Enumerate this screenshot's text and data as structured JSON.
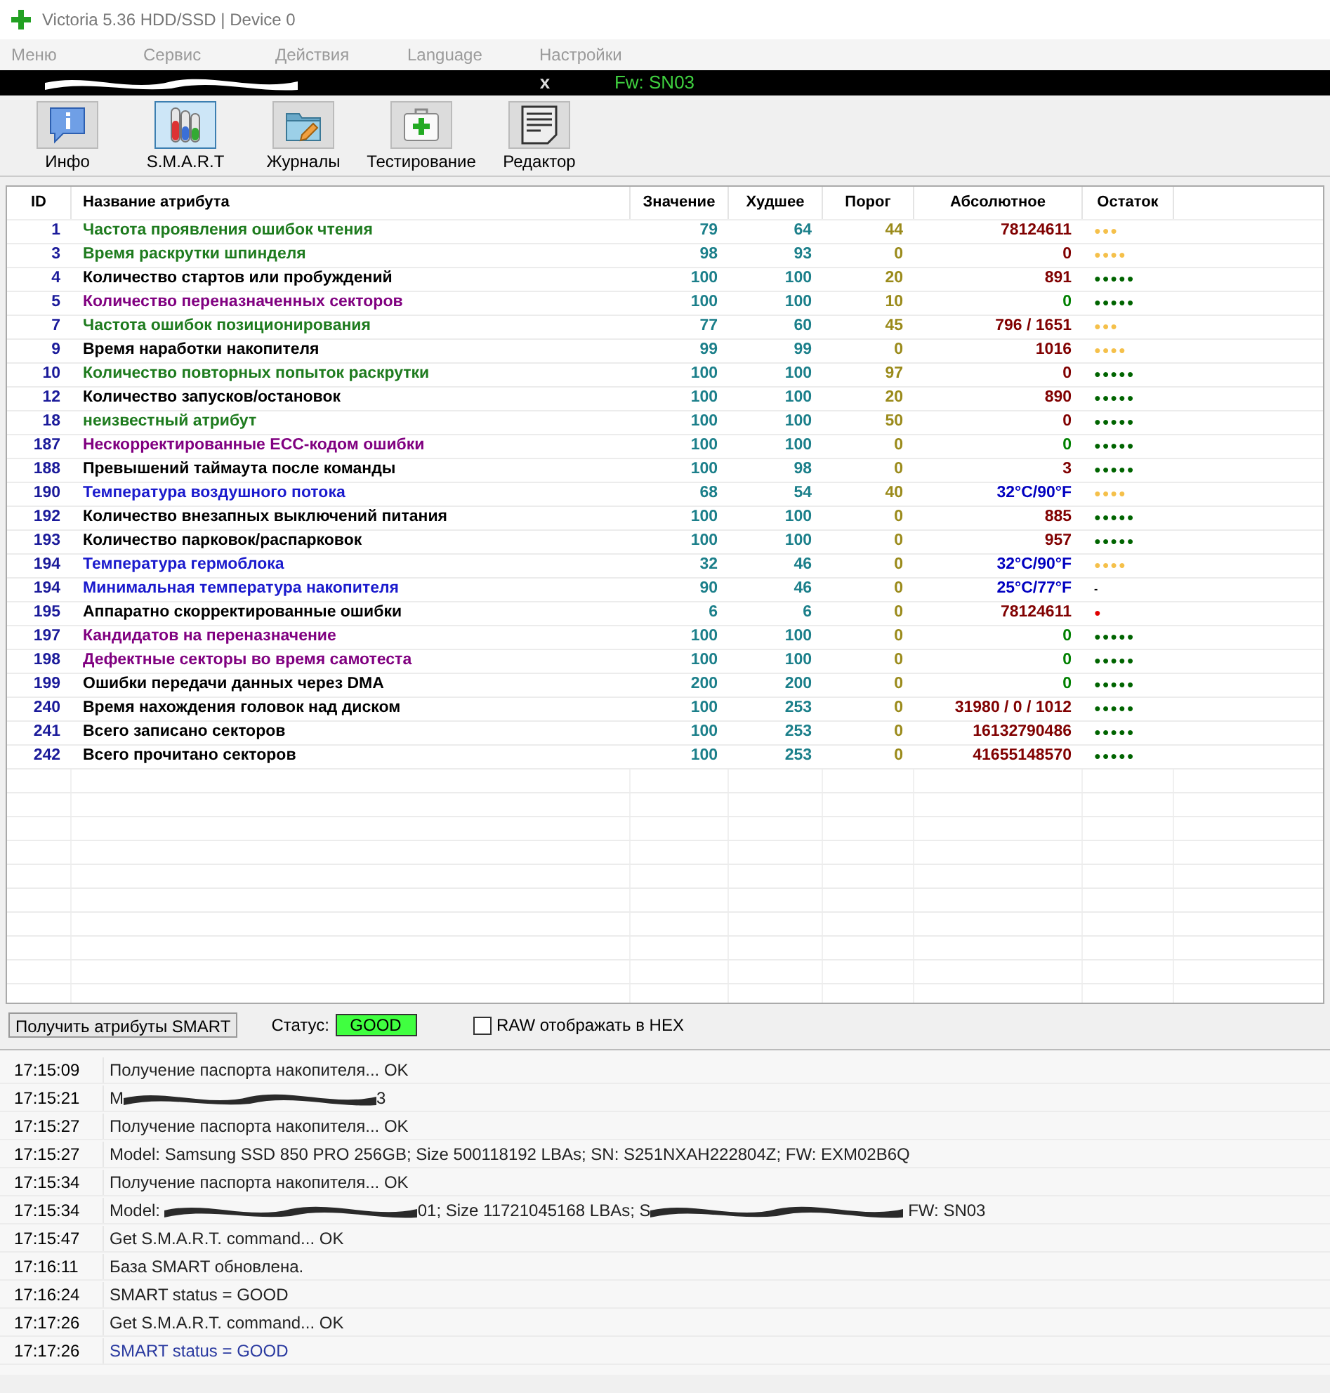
{
  "window": {
    "title": "Victoria 5.36 HDD/SSD | Device 0"
  },
  "menu": [
    "Меню",
    "Сервис",
    "Действия",
    "Language",
    "Настройки"
  ],
  "device_bar": {
    "close": "x",
    "firmware": "Fw: SN03"
  },
  "toolbar": [
    {
      "label": "Инфо",
      "kind": "info",
      "selected": false
    },
    {
      "label": "S.M.A.R.T",
      "kind": "smart",
      "selected": true
    },
    {
      "label": "Журналы",
      "kind": "logs",
      "selected": false
    },
    {
      "label": "Тестирование",
      "kind": "test",
      "selected": false
    },
    {
      "label": "Редактор",
      "kind": "editor",
      "selected": false
    }
  ],
  "table": {
    "columns": [
      "ID",
      "Название атрибута",
      "Значение",
      "Худшее",
      "Порог",
      "Абсолютное",
      "Остаток"
    ],
    "rows": [
      {
        "id": "1",
        "name": {
          "text": "Частота проявления ошибок чтения",
          "color": "#1e7b1e"
        },
        "value": "79",
        "worst": "64",
        "threshold": "44",
        "raw": {
          "text": "78124611",
          "color": "#800000"
        },
        "remaining": {
          "text": "●●●",
          "color": "#f5c04a"
        }
      },
      {
        "id": "3",
        "name": {
          "text": "Время раскрутки шпинделя",
          "color": "#1e7b1e"
        },
        "value": "98",
        "worst": "93",
        "threshold": "0",
        "raw": {
          "text": "0",
          "color": "#800000"
        },
        "remaining": {
          "text": "●●●●",
          "color": "#f5c04a"
        }
      },
      {
        "id": "4",
        "name": {
          "text": "Количество стартов или пробуждений",
          "color": "#000000"
        },
        "value": "100",
        "worst": "100",
        "threshold": "20",
        "raw": {
          "text": "891",
          "color": "#800000"
        },
        "remaining": {
          "text": "●●●●●",
          "color": "#006400"
        }
      },
      {
        "id": "5",
        "name": {
          "text": "Количество переназначенных секторов",
          "color": "#800080"
        },
        "value": "100",
        "worst": "100",
        "threshold": "10",
        "raw": {
          "text": "0",
          "color": "#008000"
        },
        "remaining": {
          "text": "●●●●●",
          "color": "#006400"
        }
      },
      {
        "id": "7",
        "name": {
          "text": "Частота ошибок позиционирования",
          "color": "#1e7b1e"
        },
        "value": "77",
        "worst": "60",
        "threshold": "45",
        "raw": {
          "text": "796 / 1651",
          "color": "#800000"
        },
        "remaining": {
          "text": "●●●",
          "color": "#f5c04a"
        }
      },
      {
        "id": "9",
        "name": {
          "text": "Время наработки накопителя",
          "color": "#000000"
        },
        "value": "99",
        "worst": "99",
        "threshold": "0",
        "raw": {
          "text": "1016",
          "color": "#800000"
        },
        "remaining": {
          "text": "●●●●",
          "color": "#f5c04a"
        }
      },
      {
        "id": "10",
        "name": {
          "text": "Количество повторных попыток раскрутки",
          "color": "#1e7b1e"
        },
        "value": "100",
        "worst": "100",
        "threshold": "97",
        "raw": {
          "text": "0",
          "color": "#800000"
        },
        "remaining": {
          "text": "●●●●●",
          "color": "#006400"
        }
      },
      {
        "id": "12",
        "name": {
          "text": "Количество запусков/остановок",
          "color": "#000000"
        },
        "value": "100",
        "worst": "100",
        "threshold": "20",
        "raw": {
          "text": "890",
          "color": "#800000"
        },
        "remaining": {
          "text": "●●●●●",
          "color": "#006400"
        }
      },
      {
        "id": "18",
        "name": {
          "text": "неизвестный атрибут",
          "color": "#1e7b1e"
        },
        "value": "100",
        "worst": "100",
        "threshold": "50",
        "raw": {
          "text": "0",
          "color": "#800000"
        },
        "remaining": {
          "text": "●●●●●",
          "color": "#006400"
        }
      },
      {
        "id": "187",
        "name": {
          "text": "Нескорректированные ECC-кодом ошибки",
          "color": "#800080"
        },
        "value": "100",
        "worst": "100",
        "threshold": "0",
        "raw": {
          "text": "0",
          "color": "#008000"
        },
        "remaining": {
          "text": "●●●●●",
          "color": "#006400"
        }
      },
      {
        "id": "188",
        "name": {
          "text": "Превышений таймаута после команды",
          "color": "#000000"
        },
        "value": "100",
        "worst": "98",
        "threshold": "0",
        "raw": {
          "text": "3",
          "color": "#800000"
        },
        "remaining": {
          "text": "●●●●●",
          "color": "#006400"
        }
      },
      {
        "id": "190",
        "name": {
          "text": "Температура воздушного потока",
          "color": "#1a1acd"
        },
        "value": "68",
        "worst": "54",
        "threshold": "40",
        "raw": {
          "text": "32°C/90°F",
          "color": "#0000c0"
        },
        "remaining": {
          "text": "●●●●",
          "color": "#f5c04a"
        }
      },
      {
        "id": "192",
        "name": {
          "text": "Количество внезапных выключений питания",
          "color": "#000000"
        },
        "value": "100",
        "worst": "100",
        "threshold": "0",
        "raw": {
          "text": "885",
          "color": "#800000"
        },
        "remaining": {
          "text": "●●●●●",
          "color": "#006400"
        }
      },
      {
        "id": "193",
        "name": {
          "text": "Количество парковок/распарковок",
          "color": "#000000"
        },
        "value": "100",
        "worst": "100",
        "threshold": "0",
        "raw": {
          "text": "957",
          "color": "#800000"
        },
        "remaining": {
          "text": "●●●●●",
          "color": "#006400"
        }
      },
      {
        "id": "194",
        "name": {
          "text": "Температура гермоблока",
          "color": "#1a1acd"
        },
        "value": "32",
        "worst": "46",
        "threshold": "0",
        "raw": {
          "text": "32°C/90°F",
          "color": "#0000c0"
        },
        "remaining": {
          "text": "●●●●",
          "color": "#f5c04a"
        }
      },
      {
        "id": "194",
        "name": {
          "text": "Минимальная температура накопителя",
          "color": "#1a1acd"
        },
        "value": "90",
        "worst": "46",
        "threshold": "0",
        "raw": {
          "text": "25°C/77°F",
          "color": "#0000c0"
        },
        "remaining": {
          "text": "-",
          "color": "#000000"
        }
      },
      {
        "id": "195",
        "name": {
          "text": "Аппаратно скорректированные ошибки",
          "color": "#000000"
        },
        "value": "6",
        "worst": "6",
        "threshold": "0",
        "raw": {
          "text": "78124611",
          "color": "#800000"
        },
        "remaining": {
          "text": "●",
          "color": "#e00000"
        }
      },
      {
        "id": "197",
        "name": {
          "text": "Кандидатов на переназначение",
          "color": "#800080"
        },
        "value": "100",
        "worst": "100",
        "threshold": "0",
        "raw": {
          "text": "0",
          "color": "#008000"
        },
        "remaining": {
          "text": "●●●●●",
          "color": "#006400"
        }
      },
      {
        "id": "198",
        "name": {
          "text": "Дефектные секторы во время самотеста",
          "color": "#800080"
        },
        "value": "100",
        "worst": "100",
        "threshold": "0",
        "raw": {
          "text": "0",
          "color": "#008000"
        },
        "remaining": {
          "text": "●●●●●",
          "color": "#006400"
        }
      },
      {
        "id": "199",
        "name": {
          "text": "Ошибки передачи данных через DMA",
          "color": "#000000"
        },
        "value": "200",
        "worst": "200",
        "threshold": "0",
        "raw": {
          "text": "0",
          "color": "#008000"
        },
        "remaining": {
          "text": "●●●●●",
          "color": "#006400"
        }
      },
      {
        "id": "240",
        "name": {
          "text": "Время нахождения головок над диском",
          "color": "#000000"
        },
        "value": "100",
        "worst": "253",
        "threshold": "0",
        "raw": {
          "text": "31980 / 0 / 1012",
          "color": "#800000"
        },
        "remaining": {
          "text": "●●●●●",
          "color": "#006400"
        }
      },
      {
        "id": "241",
        "name": {
          "text": "Всего записано секторов",
          "color": "#000000"
        },
        "value": "100",
        "worst": "253",
        "threshold": "0",
        "raw": {
          "text": "16132790486",
          "color": "#800000"
        },
        "remaining": {
          "text": "●●●●●",
          "color": "#006400"
        }
      },
      {
        "id": "242",
        "name": {
          "text": "Всего прочитано секторов",
          "color": "#000000"
        },
        "value": "100",
        "worst": "253",
        "threshold": "0",
        "raw": {
          "text": "41655148570",
          "color": "#800000"
        },
        "remaining": {
          "text": "●●●●●",
          "color": "#006400"
        }
      }
    ]
  },
  "controls": {
    "button": "Получить атрибуты SMART",
    "status_label": "Статус:",
    "status": "GOOD",
    "hex_checkbox": {
      "label": "RAW отображать в HEX",
      "checked": false
    }
  },
  "log": [
    {
      "time": "17:15:09",
      "parts": [
        {
          "kind": "text",
          "text": "Получение паспорта накопителя... OK"
        }
      ]
    },
    {
      "time": "17:15:21",
      "parts": [
        {
          "kind": "text",
          "text": "M"
        },
        {
          "kind": "redacted"
        },
        {
          "kind": "text",
          "text": "3"
        }
      ]
    },
    {
      "time": "17:15:27",
      "parts": [
        {
          "kind": "text",
          "text": "Получение паспорта накопителя... OK"
        }
      ]
    },
    {
      "time": "17:15:27",
      "parts": [
        {
          "kind": "text",
          "text": "Model: Samsung SSD 850 PRO 256GB; Size 500118192 LBAs; SN: S251NXAH222804Z; FW: EXM02B6Q"
        }
      ]
    },
    {
      "time": "17:15:34",
      "parts": [
        {
          "kind": "text",
          "text": "Получение паспорта накопителя... OK"
        }
      ]
    },
    {
      "time": "17:15:34",
      "parts": [
        {
          "kind": "text",
          "text": "Model: "
        },
        {
          "kind": "redacted"
        },
        {
          "kind": "text",
          "text": "01; Size 11721045168 LBAs; S"
        },
        {
          "kind": "redacted"
        },
        {
          "kind": "text",
          "text": " FW: SN03"
        }
      ]
    },
    {
      "time": "17:15:47",
      "parts": [
        {
          "kind": "text",
          "text": "Get S.M.A.R.T. command... OK"
        }
      ]
    },
    {
      "time": "17:16:11",
      "parts": [
        {
          "kind": "text",
          "text": "База SMART обновлена."
        }
      ]
    },
    {
      "time": "17:16:24",
      "parts": [
        {
          "kind": "text",
          "text": "SMART status = GOOD"
        }
      ]
    },
    {
      "time": "17:17:26",
      "parts": [
        {
          "kind": "text",
          "text": "Get S.M.A.R.T. command... OK"
        }
      ]
    },
    {
      "time": "17:17:26",
      "parts": [
        {
          "kind": "text",
          "text": "SMART status = GOOD"
        }
      ],
      "highlight": true
    }
  ]
}
